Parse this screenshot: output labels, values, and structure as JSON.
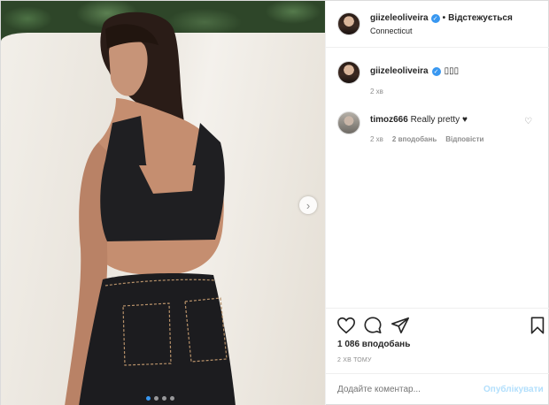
{
  "post": {
    "username": "giizeleoliveira",
    "follow_status": "Відстежується",
    "location": "Connecticut"
  },
  "caption": {
    "username": "giizeleoliveira",
    "emoji_text": "▯▯▯",
    "time": "2 хв"
  },
  "comment": {
    "username": "timoz666",
    "text": "Really pretty",
    "emoji": "♥",
    "time": "2 хв",
    "likes": "2 вподобань",
    "reply": "Відповісти"
  },
  "stats": {
    "likes": "1 086 вподобань",
    "posted_ago": "2 ХВ ТОМУ"
  },
  "composer": {
    "placeholder": "Додайте коментар...",
    "post_label": "Опублікувати"
  },
  "icons": {
    "like": "heart-icon",
    "comment": "comment-icon",
    "share": "share-icon",
    "save": "bookmark-icon",
    "next": "chevron-right-icon"
  },
  "colors": {
    "verified": "#3897f0",
    "post_disabled": "#b2dffc"
  }
}
